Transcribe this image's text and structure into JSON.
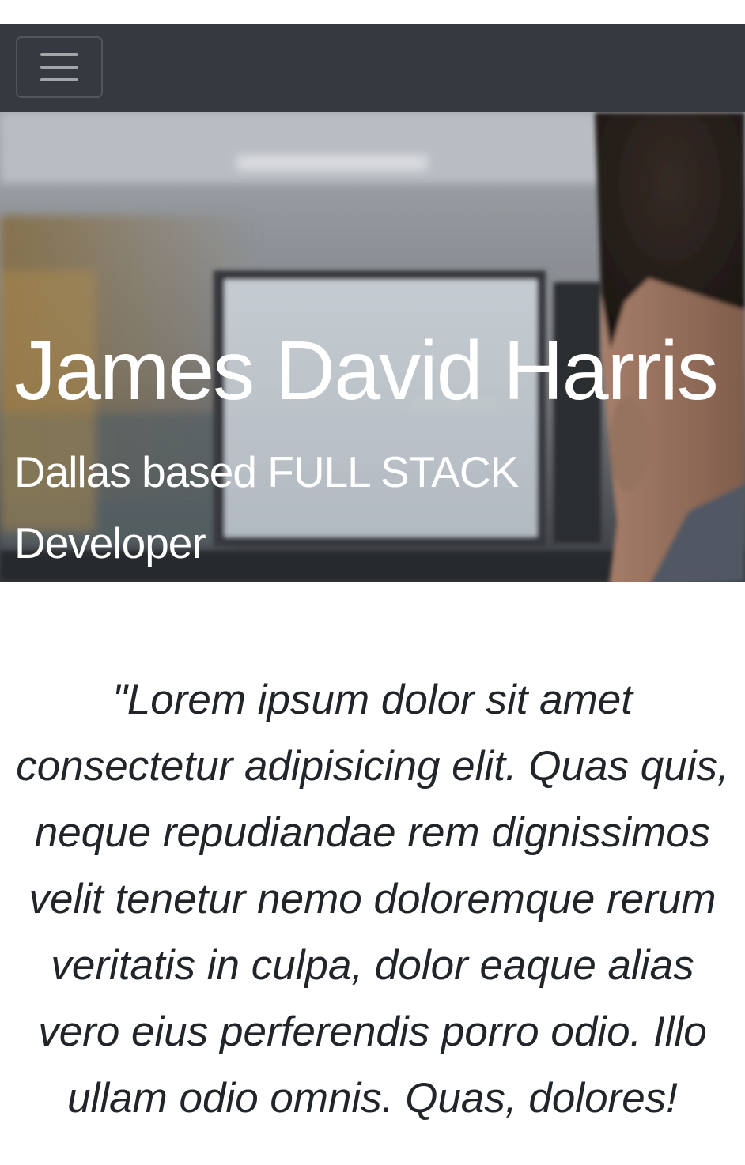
{
  "navbar": {
    "toggler_icon": "hamburger-menu-icon",
    "background": "#343a40"
  },
  "hero": {
    "title": "James David Harris",
    "subtitle": "Dallas based FULL STACK Developer"
  },
  "quote": {
    "text": "\"Lorem ipsum dolor sit amet consectetur adipisicing elit. Quas quis, neque repudiandae rem dignissimos velit tenetur nemo doloremque rerum veritatis in culpa, dolor eaque alias vero eius perferendis porro odio. Illo ullam odio omnis. Quas, dolores!"
  }
}
